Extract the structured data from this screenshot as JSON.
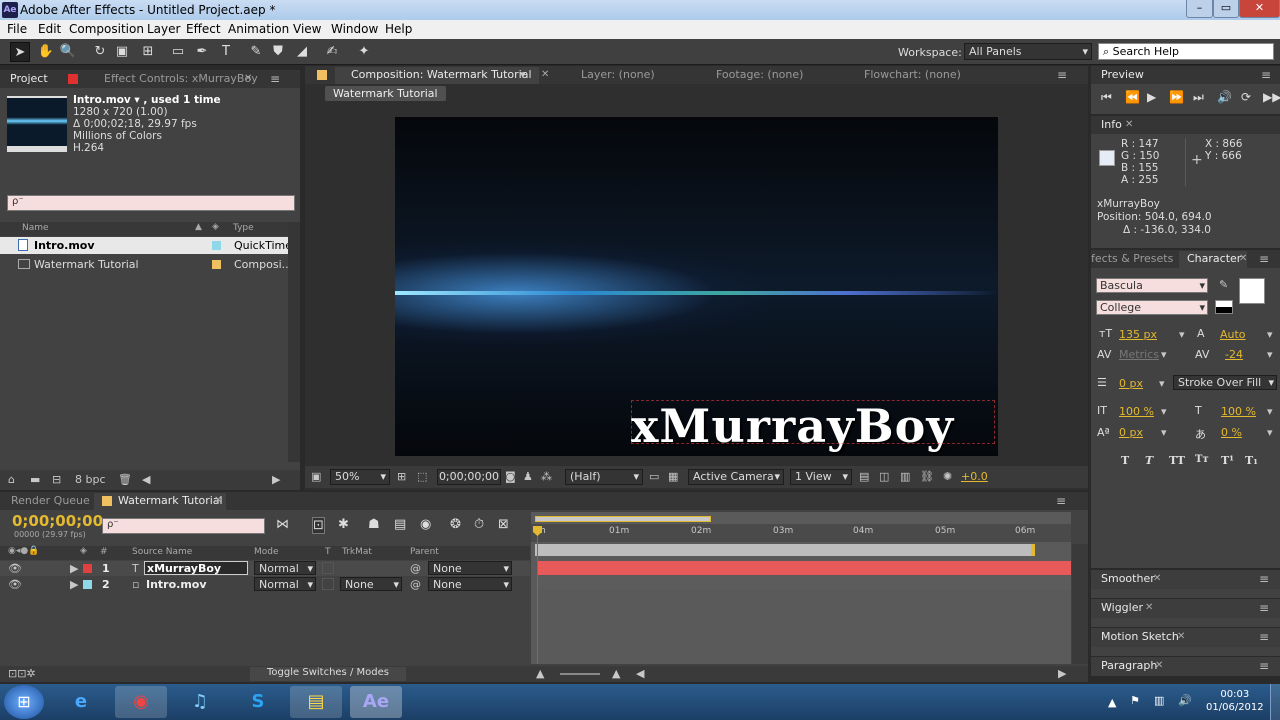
{
  "window": {
    "title": "Adobe After Effects - Untitled Project.aep *",
    "logo": "Ae",
    "minimize": "–",
    "maximize": "▭",
    "close": "✕"
  },
  "menu": [
    "File",
    "Edit",
    "Composition",
    "Layer",
    "Effect",
    "Animation",
    "View",
    "Window",
    "Help"
  ],
  "toolbar": {
    "workspace_label": "Workspace:",
    "workspace_value": "All Panels",
    "search_help": "Search Help"
  },
  "project": {
    "tab_project": "Project",
    "tab_effect": "Effect Controls: xMurrayBoy",
    "info_name": "Intro.mov ▾ , used 1 time",
    "info_size": "1280 x 720 (1.00)",
    "info_dur": "Δ 0;00;02;18, 29.97 fps",
    "info_colors": "Millions of Colors",
    "info_codec": "H.264",
    "search_placeholder": "ρ⁻",
    "col_name": "Name",
    "col_type": "Type",
    "items": [
      {
        "name": "Intro.mov",
        "type": "QuickTime",
        "color": "#8fd8e8"
      },
      {
        "name": "Watermark Tutorial",
        "type": "Composi...",
        "color": "#f0c060"
      }
    ],
    "bpc": "8 bpc"
  },
  "comp": {
    "tab_comp": "Composition: Watermark Tutorial",
    "tab_layer": "Layer: (none)",
    "tab_footage": "Footage: (none)",
    "tab_flowchart": "Flowchart: (none)",
    "breadcrumb": "Watermark Tutorial",
    "watermark_text": "xMurrayBoy",
    "zoom": "50%",
    "timecode": "0;00;00;00",
    "resolution": "(Half)",
    "camera": "Active Camera",
    "views": "1 View",
    "exposure": "+0.0"
  },
  "preview": {
    "tab": "Preview"
  },
  "info": {
    "tab": "Info",
    "r": "R : 147",
    "g": "G : 150",
    "b": "B : 155",
    "a": "A : 255",
    "x": "X : 866",
    "y": "Y : 666",
    "layer": "xMurrayBoy",
    "position": "Position: 504.0, 694.0",
    "delta": "Δ : -136.0, 334.0"
  },
  "character": {
    "tab_effects": "fects & Presets",
    "tab_char": "Character",
    "font": "Bascula",
    "style": "College",
    "size": "135 px",
    "leading": "Auto",
    "kerning": "Metrics",
    "tracking": "-24",
    "stroke_width": "0 px",
    "stroke_mode": "Stroke Over Fill",
    "vscale": "100 %",
    "hscale": "100 %",
    "baseline": "0 px",
    "tsume": "0 %"
  },
  "side_panels": [
    "Smoother",
    "Wiggler",
    "Motion Sketch",
    "Paragraph"
  ],
  "timeline": {
    "tab_render": "Render Queue",
    "tab_comp": "Watermark Tutorial",
    "timecode": "0;00;00;00",
    "fps": "00000 (29.97 fps)",
    "search_placeholder": "ρ⁻",
    "col_source": "Source Name",
    "col_mode": "Mode",
    "col_t": "T",
    "col_trkmat": "TrkMat",
    "col_parent": "Parent",
    "layers": [
      {
        "num": "1",
        "name": "xMurrayBoy",
        "mode": "Normal",
        "trkmat": "",
        "parent": "None",
        "color": "#e04040",
        "kind": "T"
      },
      {
        "num": "2",
        "name": "Intro.mov",
        "mode": "Normal",
        "trkmat": "None",
        "parent": "None",
        "color": "#8fd8e8",
        "kind": "▫"
      }
    ],
    "ruler": [
      "m",
      "01m",
      "02m",
      "03m",
      "04m",
      "05m",
      "06m"
    ],
    "toggle": "Toggle Switches / Modes"
  },
  "taskbar": {
    "time": "00:03",
    "date": "01/06/2012"
  }
}
